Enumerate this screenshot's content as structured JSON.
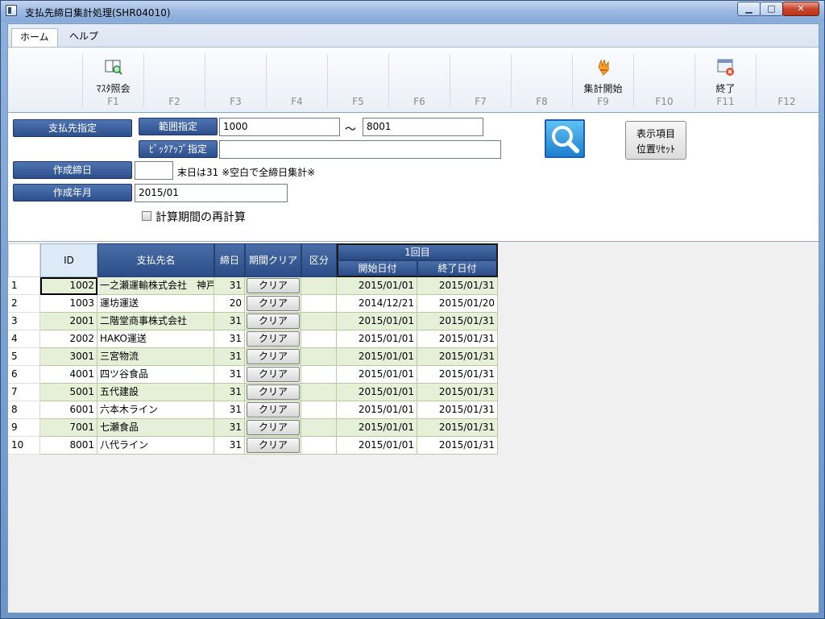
{
  "window": {
    "title": "支払先締日集計処理(SHR04010)",
    "min": "▁",
    "max": "□",
    "close": "✕"
  },
  "menu": {
    "tabs": [
      {
        "label": "ホーム"
      },
      {
        "label": "ヘルプ"
      }
    ]
  },
  "ribbon": {
    "keys": [
      {
        "label": "ﾏｽﾀ照会",
        "key": "F1",
        "icon": "book-search-icon"
      },
      {
        "label": "",
        "key": "F2"
      },
      {
        "label": "",
        "key": "F3"
      },
      {
        "label": "",
        "key": "F4"
      },
      {
        "label": "",
        "key": "F5"
      },
      {
        "label": "",
        "key": "F6"
      },
      {
        "label": "",
        "key": "F7"
      },
      {
        "label": "",
        "key": "F8"
      },
      {
        "label": "集計開始",
        "key": "F9",
        "icon": "hand-start-icon"
      },
      {
        "label": "",
        "key": "F10"
      },
      {
        "label": "終了",
        "key": "F11",
        "icon": "exit-window-icon"
      },
      {
        "label": "",
        "key": "F12"
      }
    ]
  },
  "form": {
    "payee_label": "支払先指定",
    "range_label": "範囲指定",
    "range_from": "1000",
    "range_sep": "～",
    "range_to": "8001",
    "pickup_label": "ﾋﾟｯｸｱｯﾌﾟ指定",
    "pickup_value": "",
    "closing_label": "作成締日",
    "closing_value": "",
    "closing_note": "末日は31  ※空白で全締日集計※",
    "ym_label": "作成年月",
    "ym_value": "2015/01",
    "recalc_label": "計算期間の再計算",
    "recalc_checked": false,
    "reset_line1": "表示項目",
    "reset_line2": "位置ﾘｾｯﾄ"
  },
  "table": {
    "headers": {
      "id": "ID",
      "name": "支払先名",
      "closing": "締日",
      "clear": "期間クリア",
      "kubun": "区分",
      "round": "1回目",
      "start": "開始日付",
      "end": "終了日付"
    },
    "clear_label": "クリア",
    "rows": [
      {
        "n": "1",
        "id": "1002",
        "name": "一之瀬運輸株式会社　神戸",
        "closing": "31",
        "kubun": "",
        "start": "2015/01/01",
        "end": "2015/01/31"
      },
      {
        "n": "2",
        "id": "1003",
        "name": "運坊運送",
        "closing": "20",
        "kubun": "",
        "start": "2014/12/21",
        "end": "2015/01/20"
      },
      {
        "n": "3",
        "id": "2001",
        "name": "二階堂商事株式会社",
        "closing": "31",
        "kubun": "",
        "start": "2015/01/01",
        "end": "2015/01/31"
      },
      {
        "n": "4",
        "id": "2002",
        "name": "HAKO運送",
        "closing": "31",
        "kubun": "",
        "start": "2015/01/01",
        "end": "2015/01/31"
      },
      {
        "n": "5",
        "id": "3001",
        "name": "三宮物流",
        "closing": "31",
        "kubun": "",
        "start": "2015/01/01",
        "end": "2015/01/31"
      },
      {
        "n": "6",
        "id": "4001",
        "name": "四ツ谷食品",
        "closing": "31",
        "kubun": "",
        "start": "2015/01/01",
        "end": "2015/01/31"
      },
      {
        "n": "7",
        "id": "5001",
        "name": "五代建設",
        "closing": "31",
        "kubun": "",
        "start": "2015/01/01",
        "end": "2015/01/31"
      },
      {
        "n": "8",
        "id": "6001",
        "name": "六本木ライン",
        "closing": "31",
        "kubun": "",
        "start": "2015/01/01",
        "end": "2015/01/31"
      },
      {
        "n": "9",
        "id": "7001",
        "name": "七瀬食品",
        "closing": "31",
        "kubun": "",
        "start": "2015/01/01",
        "end": "2015/01/31"
      },
      {
        "n": "10",
        "id": "8001",
        "name": "八代ライン",
        "closing": "31",
        "kubun": "",
        "start": "2015/01/01",
        "end": "2015/01/31"
      }
    ]
  }
}
